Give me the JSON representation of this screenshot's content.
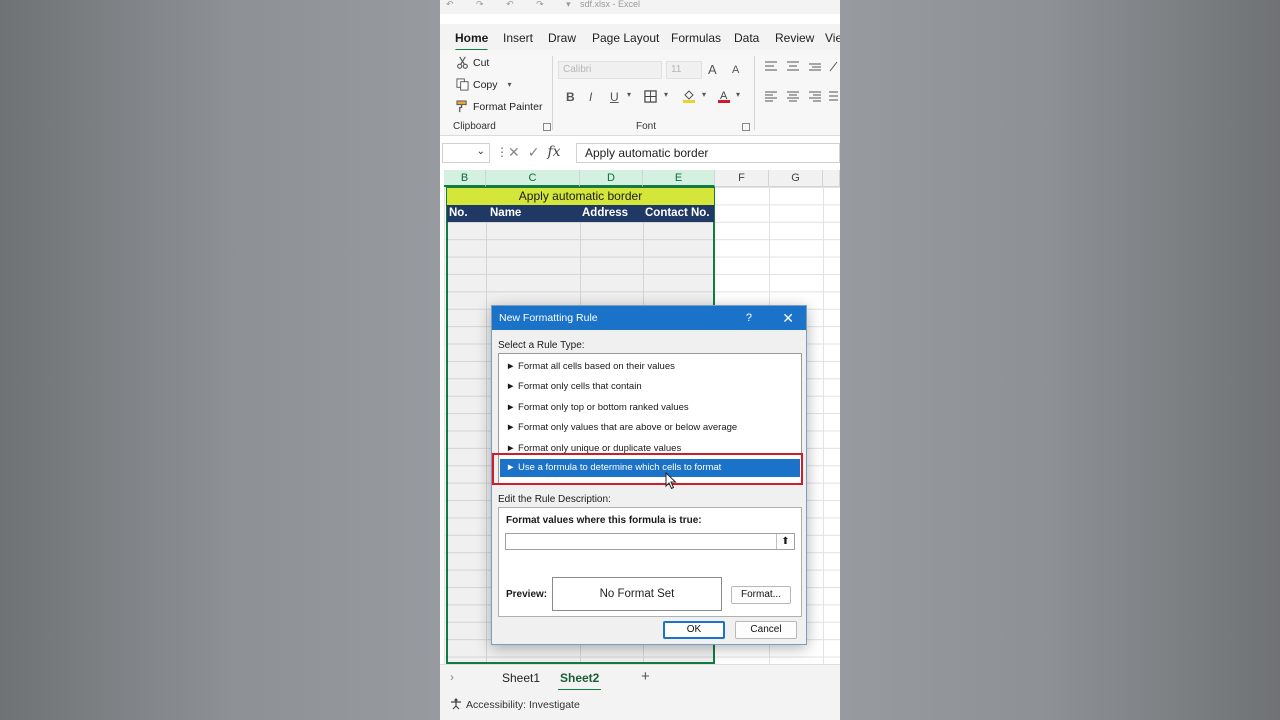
{
  "window": {
    "quick_access": "↶ ↷ ↶ ↷ ▾",
    "doc_title": "sdf.xlsx - Excel"
  },
  "menu": {
    "tabs": [
      "Home",
      "Insert",
      "Draw",
      "Page Layout",
      "Formulas",
      "Data",
      "Review",
      "Vie"
    ],
    "active": "Home"
  },
  "ribbon": {
    "clipboard": {
      "cut": "Cut",
      "copy": "Copy",
      "format_painter": "Format Painter",
      "label": "Clipboard"
    },
    "font": {
      "font_name": "Calibri",
      "font_size": "11",
      "label": "Font",
      "bold": "B",
      "italic": "I",
      "underline": "U",
      "grow": "A",
      "shrink": "A"
    }
  },
  "formula_bar": {
    "fx": "fx",
    "content": "Apply automatic border"
  },
  "columns": [
    "B",
    "C",
    "D",
    "E",
    "F",
    "G"
  ],
  "sheet": {
    "title_row": "Apply automatic border",
    "headers": [
      "No.",
      "Name",
      "Address",
      "Contact No."
    ]
  },
  "sheet_tabs": [
    "Sheet1",
    "Sheet2"
  ],
  "active_sheet": "Sheet2",
  "add_sheet": "+",
  "status": {
    "accessibility": "Accessibility: Investigate"
  },
  "dialog": {
    "title": "New Formatting Rule",
    "help": "?",
    "close": "✕",
    "select_label": "Select a Rule Type:",
    "rules": [
      "► Format all cells based on their values",
      "► Format only cells that contain",
      "► Format only top or bottom ranked values",
      "► Format only values that are above or below average",
      "► Format only unique or duplicate values",
      "► Use a formula to determine which cells to format"
    ],
    "selected_rule_index": 5,
    "edit_label": "Edit the Rule Description:",
    "formula_label": "Format values where this formula is true:",
    "formula_value": "",
    "collapse": "⬆",
    "preview_label": "Preview:",
    "preview_text": "No Format Set",
    "format_button": "Format...",
    "ok": "OK",
    "cancel": "Cancel"
  },
  "colors": {
    "excel_green": "#107c41",
    "dialog_blue": "#1a73c8",
    "title_yellow": "#d4e63a",
    "header_navy": "#1f3864",
    "highlight_red": "#d11a2a"
  }
}
